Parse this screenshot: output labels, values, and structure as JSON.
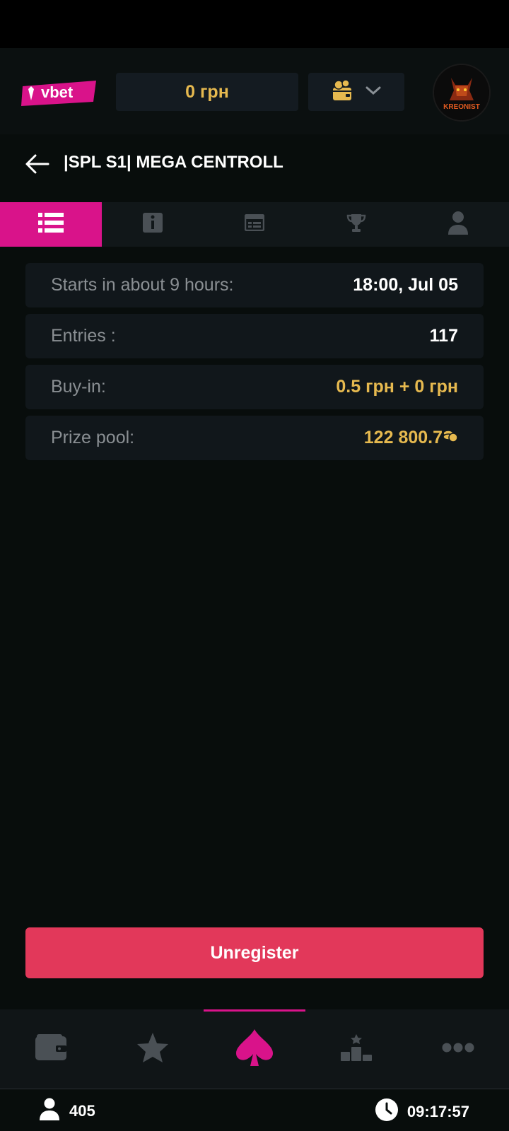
{
  "header": {
    "logo_text": "vbet",
    "balance": "0 грн",
    "avatar_text": "KREONIST"
  },
  "page": {
    "title": "|SPL S1| MEGA CENTROLL"
  },
  "tabs": [
    {
      "icon": "list-icon",
      "active": true
    },
    {
      "icon": "info-icon",
      "active": false
    },
    {
      "icon": "table-icon",
      "active": false
    },
    {
      "icon": "trophy-icon",
      "active": false
    },
    {
      "icon": "user-icon",
      "active": false
    }
  ],
  "details": {
    "starts": {
      "label": "Starts in about 9 hours:",
      "value": "18:00, Jul 05"
    },
    "entries": {
      "label": "Entries :",
      "value": "117"
    },
    "buyin": {
      "label": "Buy-in:",
      "value": "0.5 грн + 0 грн"
    },
    "prize": {
      "label": "Prize pool:",
      "value": "122 800.7"
    }
  },
  "actions": {
    "unregister_label": "Unregister"
  },
  "bottom_nav": [
    {
      "icon": "wallet-icon",
      "active": false
    },
    {
      "icon": "star-icon",
      "active": false
    },
    {
      "icon": "spade-icon",
      "active": true
    },
    {
      "icon": "leaderboard-icon",
      "active": false
    },
    {
      "icon": "more-icon",
      "active": false
    }
  ],
  "footer": {
    "online_count": "405",
    "time": "09:17:57"
  },
  "colors": {
    "accent": "#d9138a",
    "gold": "#e6b94f",
    "danger": "#e2385a"
  }
}
